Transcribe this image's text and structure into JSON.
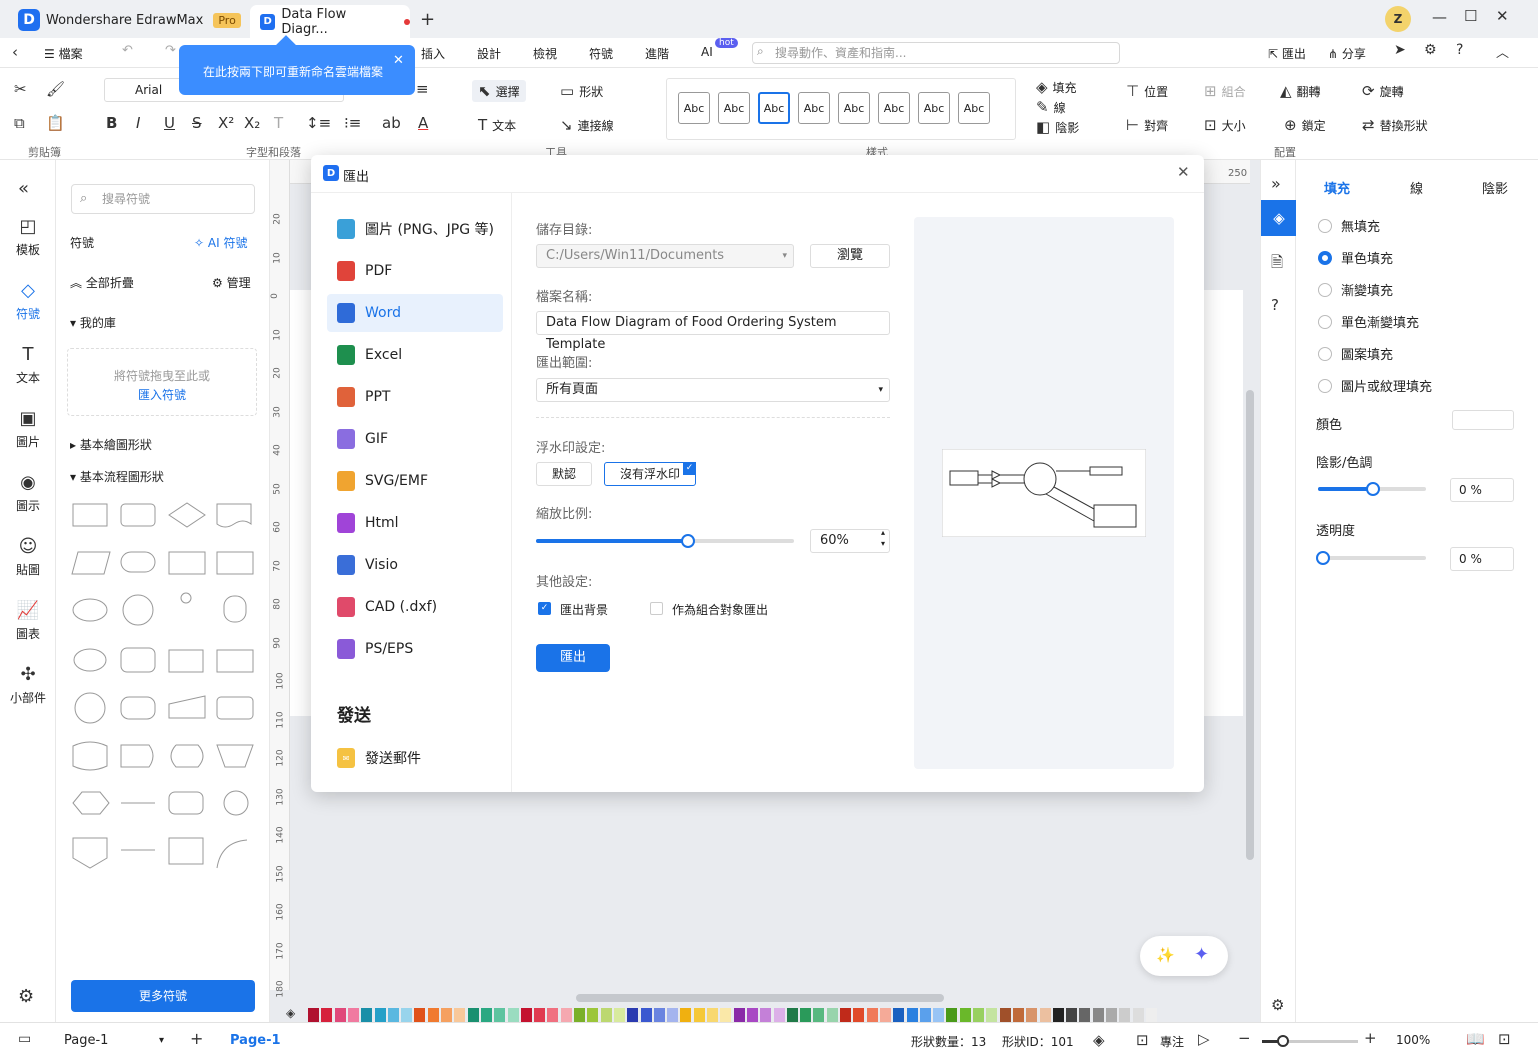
{
  "app": {
    "name": "Wondershare EdrawMax",
    "badge": "Pro"
  },
  "tab": {
    "title": "Data Flow Diagr..."
  },
  "menu": {
    "file": "檔案",
    "items": [
      "插入",
      "設計",
      "檢視",
      "符號",
      "進階",
      "AI"
    ],
    "ai_badge": "hot",
    "search_placeholder": "搜尋動作、資產和指南...",
    "export": "匯出",
    "share": "分享"
  },
  "tooltip": {
    "text": "在此按兩下即可重新命名雲端檔案"
  },
  "ribbon": {
    "font": "Arial",
    "groups": {
      "clipboard": "剪貼簿",
      "font": "字型和段落",
      "tools": "工具",
      "style": "樣式",
      "arrange": "配置"
    },
    "select": "選擇",
    "shape": "形狀",
    "text": "文本",
    "connector": "連接線",
    "fill": "填充",
    "line": "線",
    "shadow": "陰影",
    "position": "位置",
    "group": "組合",
    "flip": "翻轉",
    "rotate": "旋轉",
    "align": "對齊",
    "size": "大小",
    "lock": "鎖定",
    "replace": "替換形狀",
    "abc": "Abc"
  },
  "leftbar": [
    {
      "label": "模板",
      "icon": "template-icon"
    },
    {
      "label": "符號",
      "icon": "symbol-icon"
    },
    {
      "label": "文本",
      "icon": "text-icon"
    },
    {
      "label": "圖片",
      "icon": "image-icon"
    },
    {
      "label": "圖示",
      "icon": "icon-library-icon"
    },
    {
      "label": "貼圖",
      "icon": "sticker-icon"
    },
    {
      "label": "圖表",
      "icon": "chart-icon"
    },
    {
      "label": "小部件",
      "icon": "widget-icon"
    }
  ],
  "symbols": {
    "search_placeholder": "搜尋符號",
    "title": "符號",
    "ai": "AI 符號",
    "collapse_all": "全部折疊",
    "manage": "管理",
    "my_library": "我的庫",
    "drop_hint": "將符號拖曳至此或",
    "import": "匯入符號",
    "basic_shapes": "基本繪圖形狀",
    "basic_flowchart": "基本流程圖形狀",
    "more": "更多符號"
  },
  "dialog": {
    "title": "匯出",
    "formats": [
      "圖片 (PNG、JPG 等)",
      "PDF",
      "Word",
      "Excel",
      "PPT",
      "GIF",
      "SVG/EMF",
      "Html",
      "Visio",
      "CAD (.dxf)",
      "PS/EPS"
    ],
    "format_icons": [
      "image-format-icon",
      "pdf-icon",
      "word-icon",
      "excel-icon",
      "ppt-icon",
      "gif-icon",
      "svg-icon",
      "html-icon",
      "visio-icon",
      "cad-icon",
      "ps-icon"
    ],
    "selected": "Word",
    "send_title": "發送",
    "send_mail": "發送郵件",
    "save_dir_label": "儲存目錄:",
    "save_dir": "C:/Users/Win11/Documents",
    "browse": "瀏覽",
    "filename_label": "檔案名稱:",
    "filename": "Data Flow Diagram of Food Ordering System Template",
    "range_label": "匯出範圍:",
    "range": "所有頁面",
    "watermark_label": "浮水印設定:",
    "wm_default": "默認",
    "wm_none": "沒有浮水印",
    "scale_label": "縮放比例:",
    "scale": "60%",
    "scale_value": 0.6,
    "other_label": "其他設定:",
    "export_bg": "匯出背景",
    "export_group": "作為組合對象匯出",
    "export_btn": "匯出"
  },
  "right": {
    "tabs": [
      "填充",
      "線",
      "陰影"
    ],
    "fill_options": [
      "無填充",
      "單色填充",
      "漸變填充",
      "單色漸變填充",
      "圖案填充",
      "圖片或紋理填充"
    ],
    "color_label": "顏色",
    "shade_label": "陰影/色調",
    "shade_value": "0 %",
    "transparency_label": "透明度",
    "transparency_value": "0 %"
  },
  "ruler": {
    "left": [
      "20",
      "10",
      "0",
      "10",
      "20",
      "30",
      "40",
      "50",
      "60",
      "70",
      "80",
      "90",
      "100",
      "110",
      "120",
      "130",
      "140",
      "150",
      "160",
      "170",
      "180"
    ],
    "top_right": "250"
  },
  "status": {
    "page_select": "Page-1",
    "page_tab": "Page-1",
    "shape_count": "形狀數量：13",
    "shape_id": "形狀ID：101",
    "focus": "專注",
    "zoom": "100%"
  },
  "colors": {
    "accent": "#1a73e8",
    "brand": "#1f6ff0"
  }
}
